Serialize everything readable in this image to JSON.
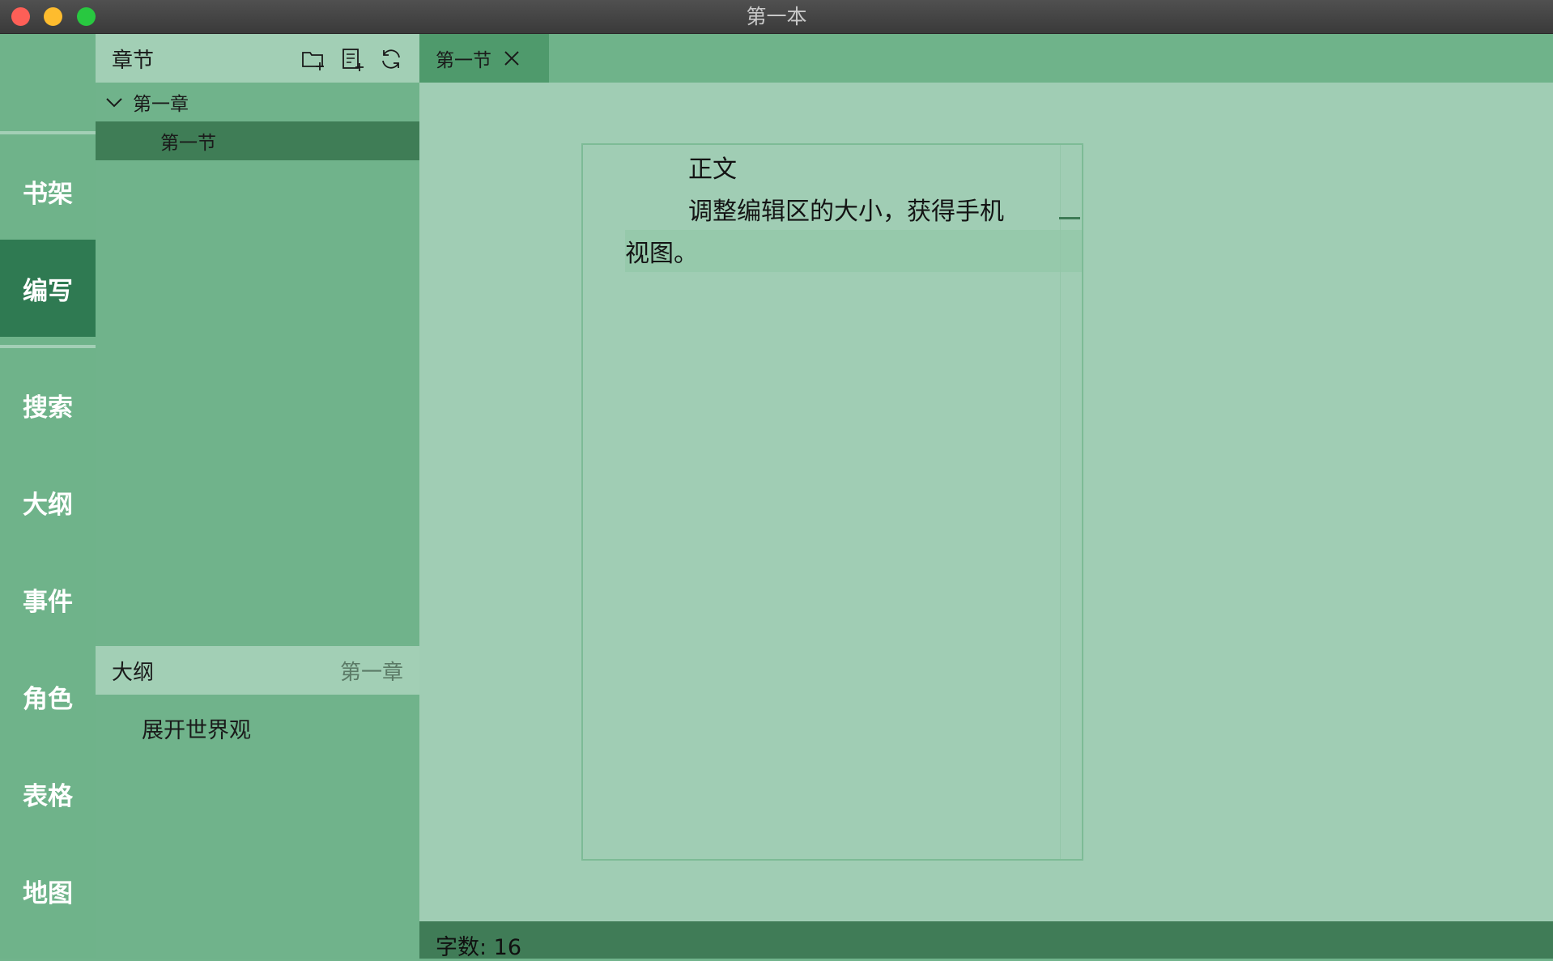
{
  "window": {
    "title": "第一本"
  },
  "nav": {
    "items": [
      {
        "label": "书架"
      },
      {
        "label": "编写",
        "active": true
      },
      {
        "label": "搜索"
      },
      {
        "label": "大纲"
      },
      {
        "label": "事件"
      },
      {
        "label": "角色"
      },
      {
        "label": "表格"
      },
      {
        "label": "地图"
      }
    ]
  },
  "chapters": {
    "title": "章节",
    "icons": [
      "new-folder-icon",
      "new-document-icon",
      "refresh-icon"
    ],
    "tree": [
      {
        "label": "第一章",
        "expanded": true
      },
      {
        "label": "第一节",
        "selected": true
      }
    ]
  },
  "outline": {
    "title": "大纲",
    "chapter": "第一章",
    "content": "展开世界观"
  },
  "tabs": [
    {
      "label": "第一节",
      "active": true
    }
  ],
  "editor": {
    "lines": [
      "正文",
      "调整编辑区的大小，获得手机",
      "视图。"
    ]
  },
  "status": {
    "word_count": "字数: 16"
  },
  "colors": {
    "nav_active": "#2f7a52",
    "panel_header": "#a2cfb5",
    "panel_body": "#70b38b",
    "editor_bg": "#a0cdb4",
    "status_bar": "#407c57"
  }
}
